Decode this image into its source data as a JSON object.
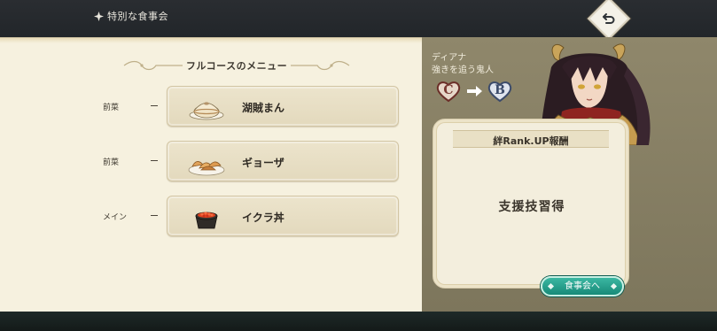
{
  "header": {
    "title": "特別な食事会"
  },
  "menu": {
    "title": "フルコースのメニュー",
    "courses": [
      {
        "label": "前菜",
        "dish": "湖賊まん",
        "icon": "steamed-bun-icon"
      },
      {
        "label": "前菜",
        "dish": "ギョーザ",
        "icon": "gyoza-icon"
      },
      {
        "label": "メイン",
        "dish": "イクラ丼",
        "icon": "ikura-don-icon"
      }
    ]
  },
  "character": {
    "name": "ディアナ",
    "subtitle": "強きを追う鬼人",
    "rank_from": "C",
    "rank_to": "B"
  },
  "reward": {
    "heading": "絆Rank.UP報酬",
    "text": "支援技習得"
  },
  "actions": {
    "dine_label": "食事会へ"
  },
  "colors": {
    "panel_cream": "#f6f1df",
    "panel_olive": "#857e63",
    "button_teal": "#1f9e89",
    "rank_c": "#7a3b34",
    "rank_b": "#3b4a6a"
  }
}
